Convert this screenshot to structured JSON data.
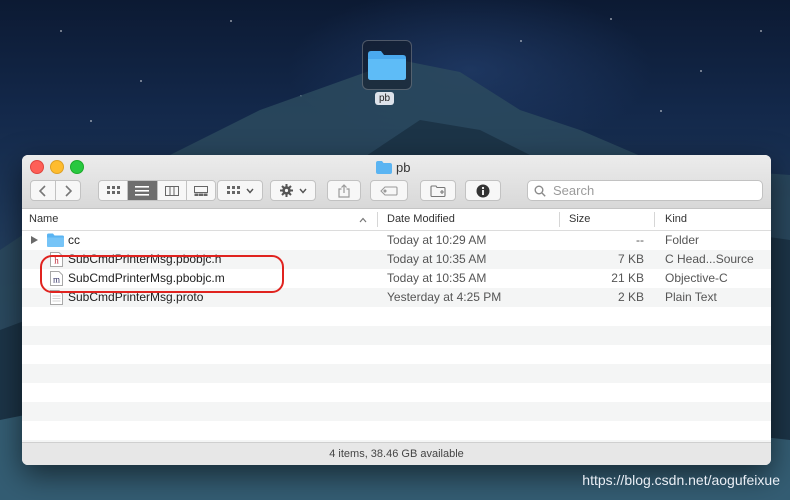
{
  "desktop": {
    "folder_label": "pb",
    "watermark": "https://blog.csdn.net/aogufeixue"
  },
  "window": {
    "title": "pb",
    "search_placeholder": "Search",
    "columns": {
      "name": "Name",
      "date_modified": "Date Modified",
      "size": "Size",
      "kind": "Kind"
    },
    "files": [
      {
        "name": "cc",
        "date": "Today at 10:29 AM",
        "size": "--",
        "kind": "Folder",
        "icon": "folder-icon"
      },
      {
        "name": "SubCmdPrinterMsg.pbobjc.h",
        "date": "Today at 10:35 AM",
        "size": "7 KB",
        "kind": "C Head...Source",
        "icon": "header-file-icon",
        "icon_letter": "h"
      },
      {
        "name": "SubCmdPrinterMsg.pbobjc.m",
        "date": "Today at 10:35 AM",
        "size": "21 KB",
        "kind": "Objective-C",
        "icon": "objc-file-icon",
        "icon_letter": "m"
      },
      {
        "name": "SubCmdPrinterMsg.proto",
        "date": "Yesterday at 4:25 PM",
        "size": "2 KB",
        "kind": "Plain Text",
        "icon": "text-file-icon"
      }
    ],
    "status": "4 items, 38.46 GB available"
  }
}
